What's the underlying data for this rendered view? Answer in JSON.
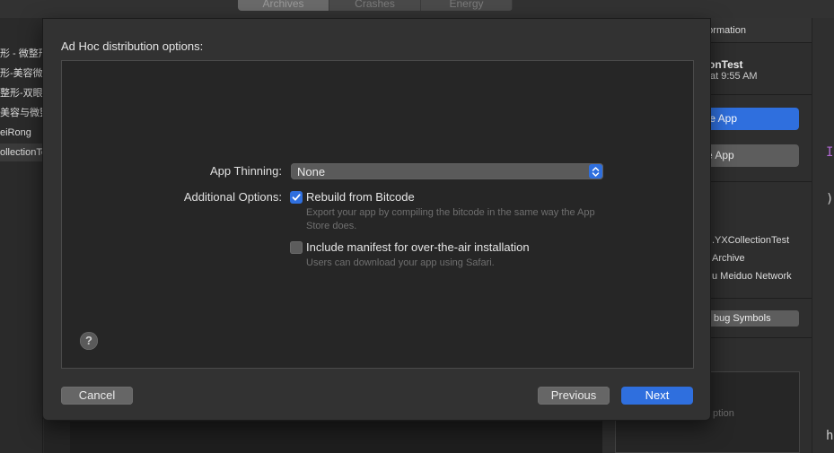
{
  "background": {
    "top_tabs": [
      "Archives",
      "Crashes",
      "Energy"
    ],
    "left_list": [
      "形 - 微整形",
      "形-美容微",
      "整形-双眼",
      "美容与微整",
      "eiRong",
      "ollectionTes"
    ],
    "right_panel": {
      "header": "nformation",
      "app_name": "onTest",
      "app_date": "at 9:55 AM",
      "distribute_button": "te App",
      "validate_button": "e App",
      "info_lines": [
        ".YXCollectionTest",
        "Archive",
        "u Meiduo Network"
      ],
      "debug_symbols_button": "bug Symbols",
      "description_placeholder": "ption"
    },
    "far_right_glyphs": [
      "I",
      ")",
      "h"
    ]
  },
  "dialog": {
    "title": "Ad Hoc distribution options:",
    "app_thinning": {
      "label": "App Thinning:",
      "value": "None"
    },
    "additional_options_label": "Additional Options:",
    "options": [
      {
        "label": "Rebuild from Bitcode",
        "checked": true,
        "description": "Export your app by compiling the bitcode in the same way the App Store does."
      },
      {
        "label": "Include manifest for over-the-air installation",
        "checked": false,
        "description": "Users can download your app using Safari."
      }
    ],
    "help_label": "?",
    "buttons": {
      "cancel": "Cancel",
      "previous": "Previous",
      "next": "Next"
    }
  },
  "colors": {
    "accent": "#2f6fde",
    "sheet_background": "#323232",
    "panel_background": "#262626"
  }
}
